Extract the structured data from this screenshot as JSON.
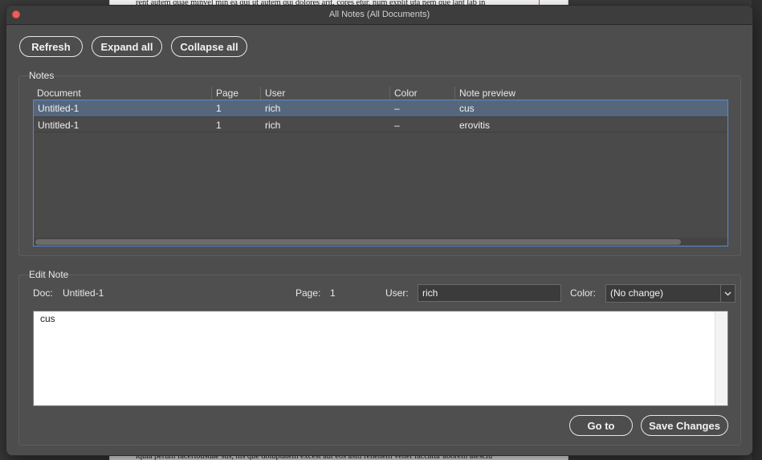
{
  "background_document": {
    "top_line": "rent autem quae minvel min ea qui ut autem qui dolores arit, cores etur, num explit uta nem que lant lab in",
    "bottom_line": "iquia perum facerlbusdae sus, nis que doluptatem excest aut eos asiti rehenem venet faccatur aborem atesciu"
  },
  "window": {
    "title": "All Notes (All Documents)"
  },
  "toolbar": {
    "refresh_label": "Refresh",
    "expand_all_label": "Expand all",
    "collapse_all_label": "Collapse all"
  },
  "notes": {
    "group_label": "Notes",
    "columns": {
      "document": "Document",
      "page": "Page",
      "user": "User",
      "color": "Color",
      "preview": "Note preview"
    },
    "rows": [
      {
        "document": "Untitled-1",
        "page": "1",
        "user": "rich",
        "color": "–",
        "preview": "cus",
        "selected": true
      },
      {
        "document": "Untitled-1",
        "page": "1",
        "user": "rich",
        "color": "–",
        "preview": "erovitis",
        "selected": false
      }
    ]
  },
  "edit_note": {
    "group_label": "Edit Note",
    "doc_label": "Doc:",
    "doc_value": "Untitled-1",
    "page_label": "Page:",
    "page_value": "1",
    "user_label": "User:",
    "user_value": "rich",
    "color_label": "Color:",
    "color_value": "(No change)",
    "note_text": "cus",
    "goto_label": "Go to",
    "save_label": "Save Changes"
  },
  "colors": {
    "window_bg": "#4d4d4d",
    "selection": "#56677c",
    "table_focus_border": "#4f8dd9",
    "close_button": "#ec5f57"
  }
}
